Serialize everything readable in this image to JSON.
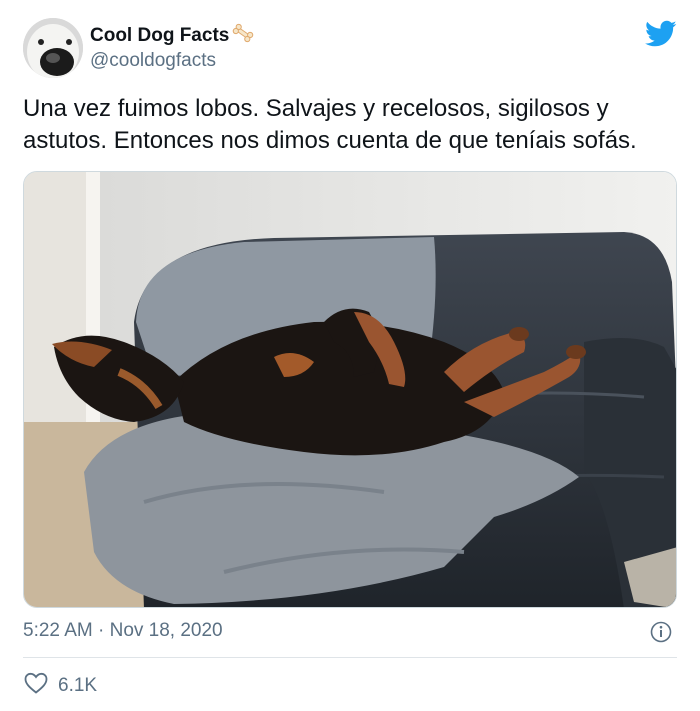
{
  "tweet": {
    "display_name": "Cool Dog Facts",
    "name_emoji_icon": "bone-icon",
    "handle": "@cooldogfacts",
    "text": "Una vez fuimos lobos. Salvajes y recelosos, sigilosos y astutos. Entonces nos dimos cuenta de que teníais sofás.",
    "timestamp": "5:22 AM · Nov 18, 2020",
    "likes": "6.1K",
    "media_icon": "photo-dog-on-sofa"
  },
  "colors": {
    "twitter_blue": "#1da1f2",
    "text_primary": "#0f1419",
    "text_secondary": "#5b7083"
  }
}
